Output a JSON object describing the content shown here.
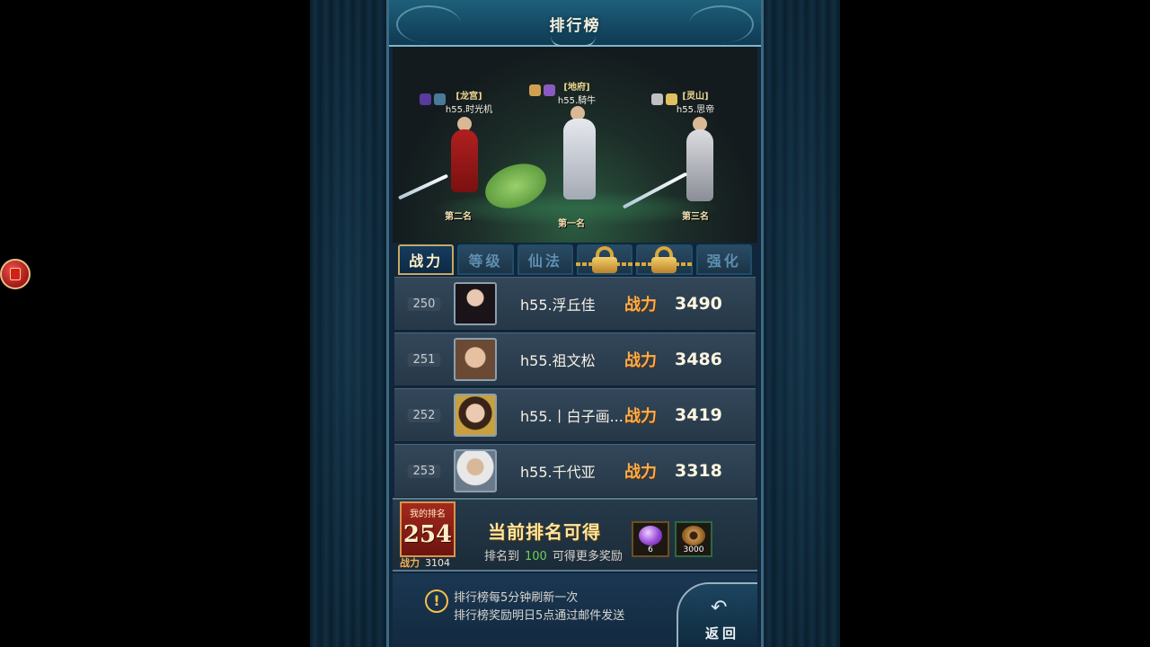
{
  "title": "排行榜",
  "top3": [
    {
      "place_label": "第一名",
      "guild": "[地府]",
      "name": "h55.騎牛"
    },
    {
      "place_label": "第二名",
      "guild": "[龙宫]",
      "name": "h55.时光机"
    },
    {
      "place_label": "第三名",
      "guild": "[灵山]",
      "name": "h55.思帝"
    }
  ],
  "tabs": [
    {
      "label": "战力",
      "active": true,
      "locked": false
    },
    {
      "label": "等级",
      "active": false,
      "locked": false
    },
    {
      "label": "仙法",
      "active": false,
      "locked": false
    },
    {
      "label": "",
      "active": false,
      "locked": true
    },
    {
      "label": "",
      "active": false,
      "locked": true
    },
    {
      "label": "强化",
      "active": false,
      "locked": false
    }
  ],
  "power_label": "战力",
  "rows": [
    {
      "rank": "250",
      "name": "h55.浮丘佳",
      "power": "3490",
      "avatar": "avatar-portrait-dark-hair"
    },
    {
      "rank": "251",
      "name": "h55.祖文松",
      "power": "3486",
      "avatar": "avatar-portrait-young-man"
    },
    {
      "rank": "252",
      "name": "h55.丨白子画...",
      "power": "3419",
      "avatar": "avatar-portrait-crowned"
    },
    {
      "rank": "253",
      "name": "h55.千代亚",
      "power": "3318",
      "avatar": "avatar-portrait-old-man"
    }
  ],
  "my_rank": {
    "title": "我的排名",
    "rank": "254",
    "power_label": "战力",
    "power": "3104"
  },
  "reward": {
    "title": "当前排名可得",
    "sub_prefix": "排名到",
    "target": "100",
    "sub_suffix": "可得更多奖励",
    "items": [
      {
        "icon": "purple-gem-icon",
        "count": "6"
      },
      {
        "icon": "copper-coin-icon",
        "count": "3000"
      }
    ]
  },
  "notices": [
    "排行榜每5分钟刷新一次",
    "排行榜奖励明日5点通过邮件发送"
  ],
  "back_label": "返回",
  "colors": {
    "accent_gold": "#f4b050",
    "active_tab_border": "#c9a860",
    "highlight_green": "#6ed05a",
    "my_rank_red": "#a32a1c"
  }
}
